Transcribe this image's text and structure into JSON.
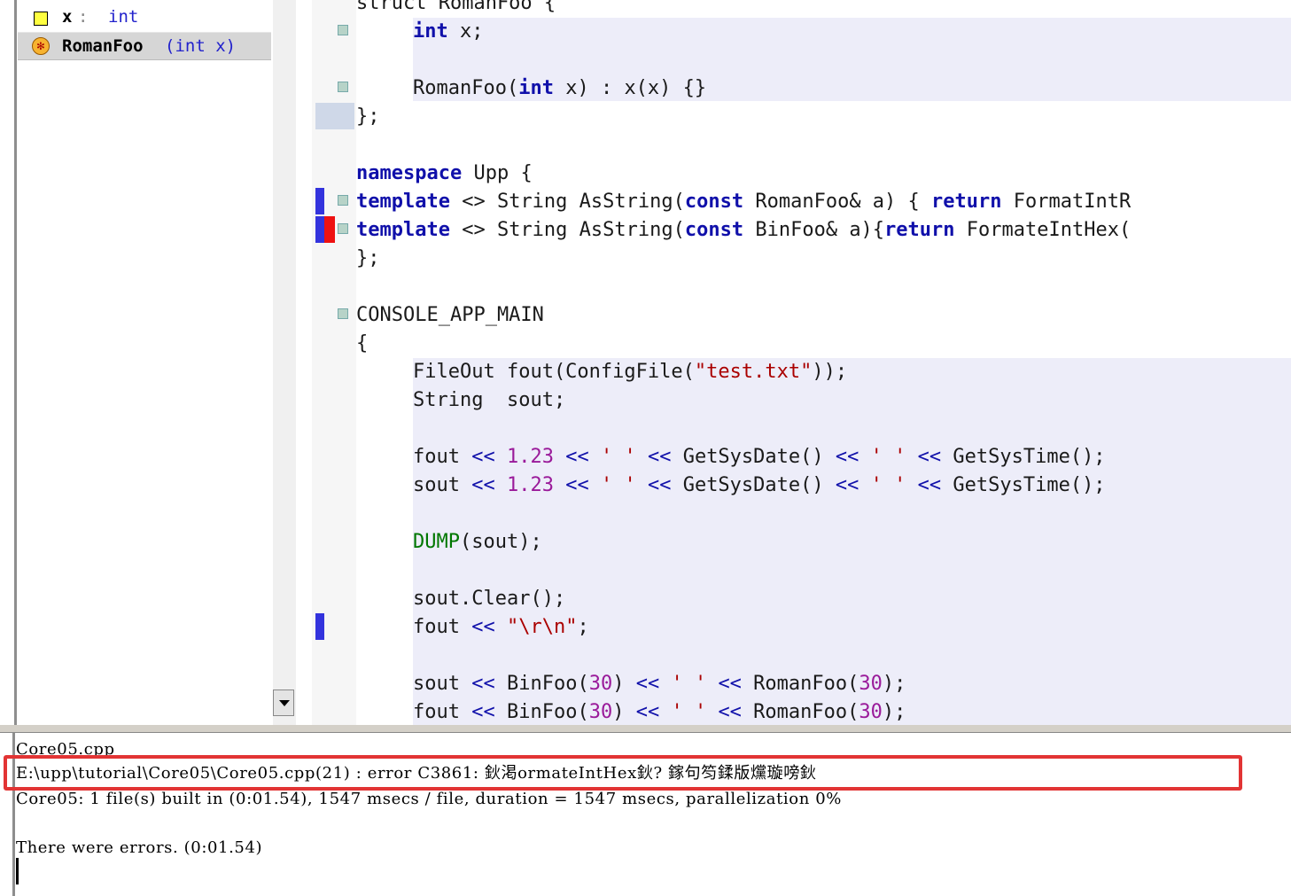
{
  "navigator": {
    "items": [
      {
        "name": "x",
        "sep": " : ",
        "type": "int",
        "icon": "member-variable-icon"
      },
      {
        "name": "RomanFoo",
        "sep": "",
        "type": "(int x)",
        "icon": "constructor-icon"
      }
    ]
  },
  "editor": {
    "lines": {
      "l_top": "struct RomanFoo {",
      "l1_kw": "int",
      "l1_rest": " x;",
      "l2_a": "RomanFoo(",
      "l2_kw": "int",
      "l2_b": " x) : x(x) {}",
      "l3": "};",
      "l4_kw": "namespace",
      "l4_rest": " Upp {",
      "l5_kw": "template",
      "l5_a": " <> String AsString(",
      "l5_kw2": "const",
      "l5_b": " RomanFoo& a) { ",
      "l5_kw3": "return",
      "l5_c": " FormatIntR",
      "l6_kw": "template",
      "l6_a": " <> String AsString(",
      "l6_kw2": "const",
      "l6_b": " BinFoo& a){",
      "l6_kw3": "return",
      "l6_c": " FormateIntHex(",
      "l7": "};",
      "l8": "CONSOLE_APP_MAIN",
      "l9": "{",
      "l10_a": "FileOut fout(ConfigFile(",
      "l10_str": "\"test.txt\"",
      "l10_b": "));",
      "l11": "String  sout;",
      "l12_a": "fout ",
      "l12_op1": "<<",
      "l12_num": " 1.23 ",
      "l12_op2": "<<",
      "l12_s1": " ' ' ",
      "l12_op3": "<<",
      "l12_b": " GetSysDate() ",
      "l12_op4": "<<",
      "l12_s2": " ' ' ",
      "l12_op5": "<<",
      "l12_c": " GetSysTime();",
      "l13_a": "sout ",
      "l13_op1": "<<",
      "l13_num": " 1.23 ",
      "l13_op2": "<<",
      "l13_s1": " ' ' ",
      "l13_op3": "<<",
      "l13_b": " GetSysDate() ",
      "l13_op4": "<<",
      "l13_s2": " ' ' ",
      "l13_op5": "<<",
      "l13_c": " GetSysTime();",
      "l14_mac": "DUMP",
      "l14_rest": "(sout);",
      "l15": "sout.Clear();",
      "l16_a": "fout ",
      "l16_op": "<<",
      "l16_str": " \"\\r\\n\"",
      "l16_b": ";",
      "l17_a": "sout ",
      "l17_op1": "<<",
      "l17_b": " BinFoo(",
      "l17_n1": "30",
      "l17_c": ") ",
      "l17_op2": "<<",
      "l17_s": " ' ' ",
      "l17_op3": "<<",
      "l17_d": " RomanFoo(",
      "l17_n2": "30",
      "l17_e": ");",
      "l18_a": "fout ",
      "l18_op1": "<<",
      "l18_b": " BinFoo(",
      "l18_n1": "30",
      "l18_c": ") ",
      "l18_op2": "<<",
      "l18_s": " ' ' ",
      "l18_op3": "<<",
      "l18_d": " RomanFoo(",
      "l18_n2": "30",
      "l18_e": ");"
    }
  },
  "output": {
    "file": "Core05.cpp",
    "error": "E:\\upp\\tutorial\\Core05\\Core05.cpp(21) : error C3861: 鈥渇ormateIntHex鈥? 鎵句笉鍒版爣璇嗙鈥",
    "summary": "Core05: 1 file(s) built in (0:01.54), 1547 msecs / file, duration = 1547 msecs, parallelization 0%",
    "status": "There were errors. (0:01.54)"
  },
  "colors": {
    "keyword": "#1010aa",
    "string": "#aa0000",
    "number": "#9a1a9a",
    "macro": "#007700",
    "error_highlight": "#e23434"
  }
}
